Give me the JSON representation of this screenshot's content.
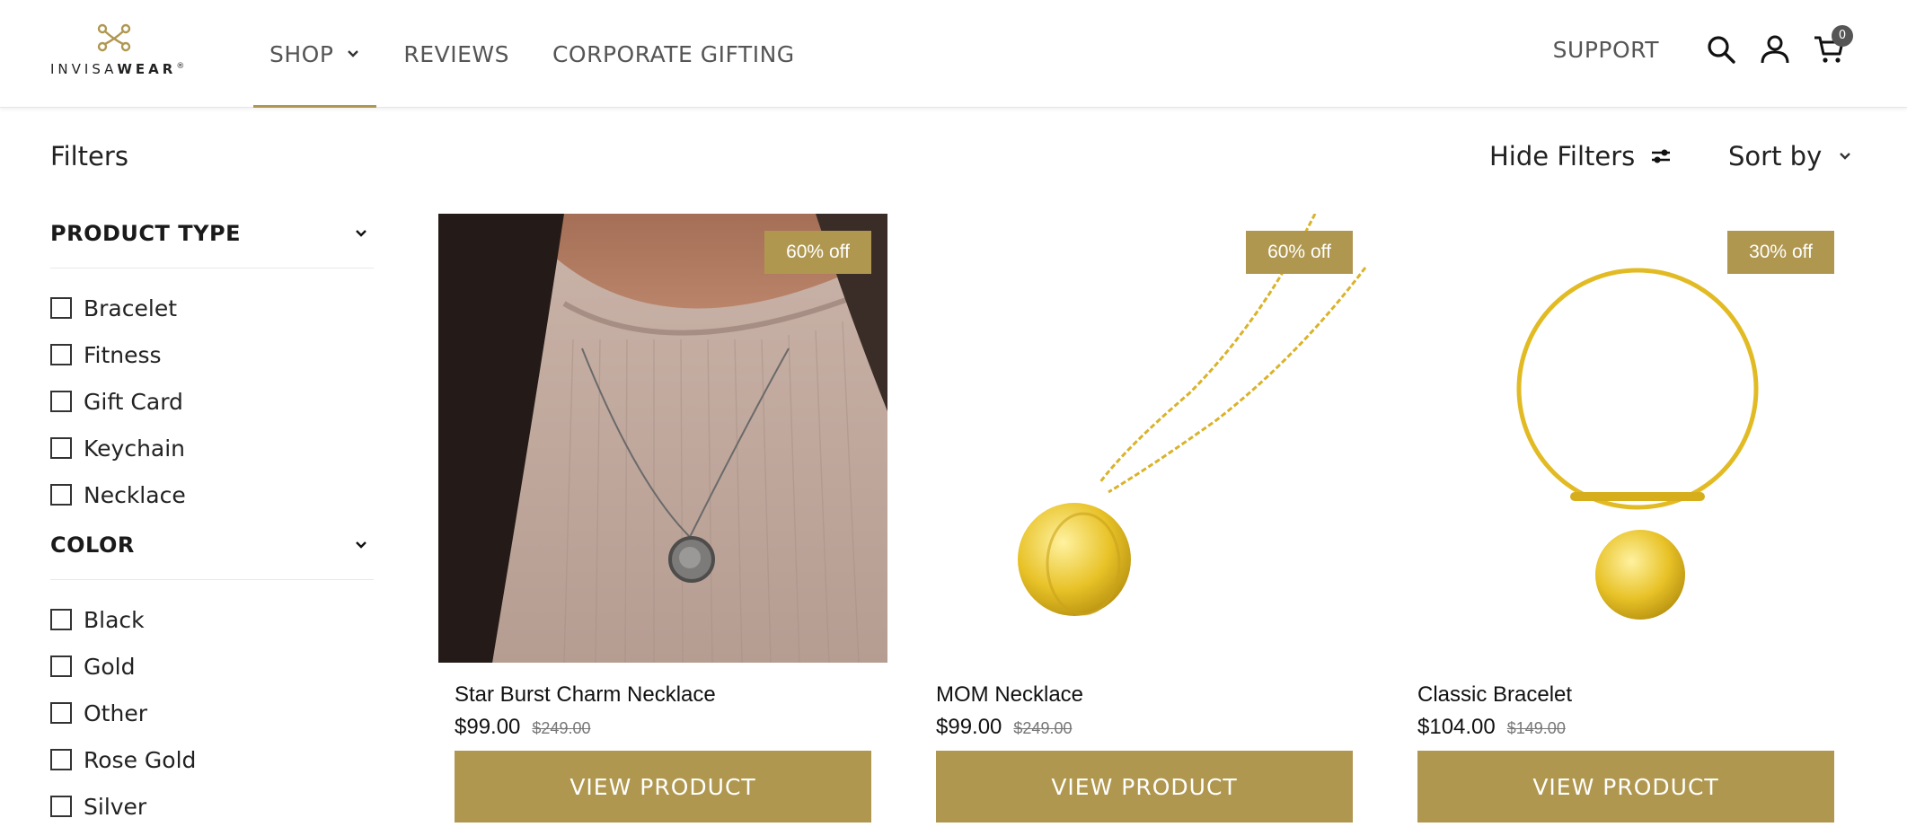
{
  "brand": {
    "name_light": "INVISA",
    "name_bold": "WEAR",
    "mark": "®"
  },
  "nav": {
    "shop": "SHOP",
    "reviews": "REVIEWS",
    "corporate": "CORPORATE GIFTING",
    "support": "SUPPORT",
    "cart_count": "0"
  },
  "toolbar": {
    "filters": "Filters",
    "hide_filters": "Hide Filters",
    "sort_by": "Sort by"
  },
  "filters": {
    "product_type": {
      "title": "PRODUCT TYPE",
      "options": [
        "Bracelet",
        "Fitness",
        "Gift Card",
        "Keychain",
        "Necklace"
      ]
    },
    "color": {
      "title": "COLOR",
      "options": [
        "Black",
        "Gold",
        "Other",
        "Rose Gold",
        "Silver"
      ]
    }
  },
  "products": [
    {
      "name": "Star Burst Charm Necklace",
      "price": "$99.00",
      "was": "$249.00",
      "badge": "60% off",
      "button": "VIEW PRODUCT"
    },
    {
      "name": "MOM Necklace",
      "price": "$99.00",
      "was": "$249.00",
      "badge": "60% off",
      "button": "VIEW PRODUCT"
    },
    {
      "name": "Classic Bracelet",
      "price": "$104.00",
      "was": "$149.00",
      "badge": "30% off",
      "button": "VIEW PRODUCT"
    }
  ],
  "colors": {
    "accent": "#b0974f",
    "text": "#222222"
  },
  "icons": [
    "search-icon",
    "account-icon",
    "cart-icon",
    "chevron-down-icon",
    "sliders-icon"
  ]
}
